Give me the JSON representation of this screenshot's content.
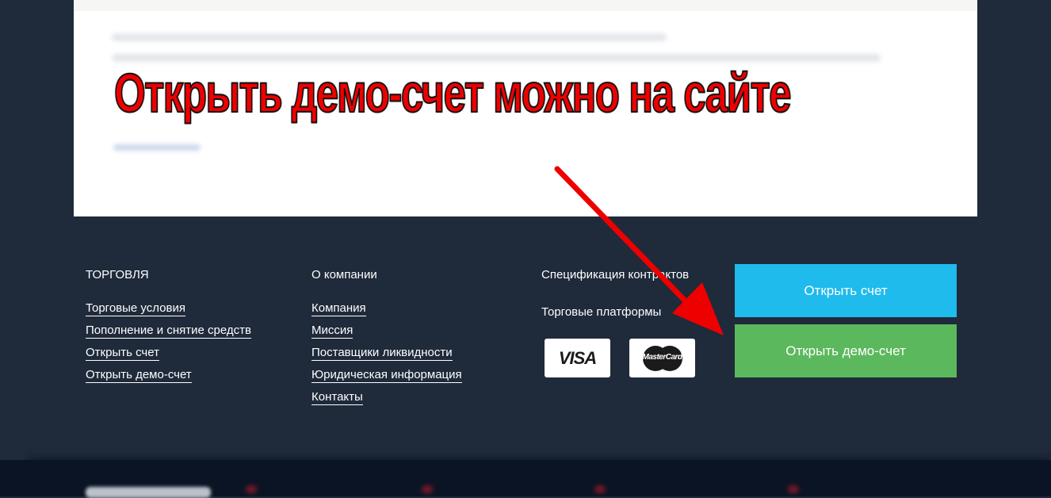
{
  "overlay": {
    "caption": "Открыть демо-счет можно на сайте"
  },
  "footer": {
    "trading": {
      "heading": "ТОРГОВЛЯ",
      "links": [
        "Торговые условия",
        "Пополнение и снятие средств",
        "Открыть счет",
        "Открыть демо-счет"
      ]
    },
    "company": {
      "heading": "О компании",
      "links": [
        "Компания",
        "Миссия",
        "Поставщики ликвидности",
        "Юридическая информация",
        "Контакты"
      ]
    },
    "specs": {
      "contracts_label": "Спецификация контрактов",
      "platforms_label": "Торговые платформы"
    },
    "payment_logos": {
      "visa": "VISA",
      "mastercard": "MasterCard"
    },
    "actions": {
      "open_account": "Открыть счет",
      "open_demo": "Открыть демо-счет"
    }
  },
  "colors": {
    "background": "#1f2a3b",
    "open_account_button": "#1fbbec",
    "open_demo_button": "#5cb85c",
    "annotation_red": "#ee0000"
  },
  "icons": [
    "visa-logo-icon",
    "mastercard-logo-icon",
    "annotation-arrow-icon"
  ]
}
